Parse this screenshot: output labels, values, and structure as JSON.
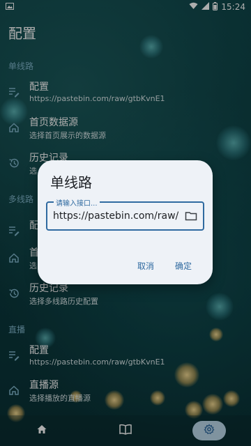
{
  "status": {
    "time": "15:24"
  },
  "app": {
    "title": "配置"
  },
  "sections": {
    "single": {
      "header": "单线路"
    },
    "multi": {
      "header": "多线路"
    },
    "live": {
      "header": "直播"
    }
  },
  "single_items": [
    {
      "title": "配置",
      "subtitle": "https://pastebin.com/raw/gtbKvnE1",
      "icon": "edit-list-icon"
    },
    {
      "title": "首页数据源",
      "subtitle": "选择首页展示的数据源",
      "icon": "home-icon"
    },
    {
      "title": "历史记录",
      "subtitle": "选",
      "icon": "history-icon"
    }
  ],
  "multi_items": [
    {
      "title": "配",
      "subtitle": "",
      "icon": "edit-list-icon"
    },
    {
      "title": "首",
      "subtitle": "选",
      "icon": "home-icon"
    },
    {
      "title": "历史记录",
      "subtitle": "选择多线路历史配置",
      "icon": "history-icon"
    }
  ],
  "live_items": [
    {
      "title": "配置",
      "subtitle": "https://pastebin.com/raw/gtbKvnE1",
      "icon": "edit-list-icon"
    },
    {
      "title": "直播源",
      "subtitle": "选择播放的直播源",
      "icon": "home-icon"
    }
  ],
  "dialog": {
    "title": "单线路",
    "field_label": "请输入接口...",
    "field_value": "https://pastebin.com/raw/",
    "cancel": "取消",
    "confirm": "确定"
  },
  "nav": [
    "home-icon",
    "book-icon",
    "gear-icon"
  ],
  "colors": {
    "accent": "#2f6aa0",
    "section_header": "#7fb4c9",
    "nav_active": "#bcd9ea",
    "dialog_bg": "#eef2f7"
  }
}
